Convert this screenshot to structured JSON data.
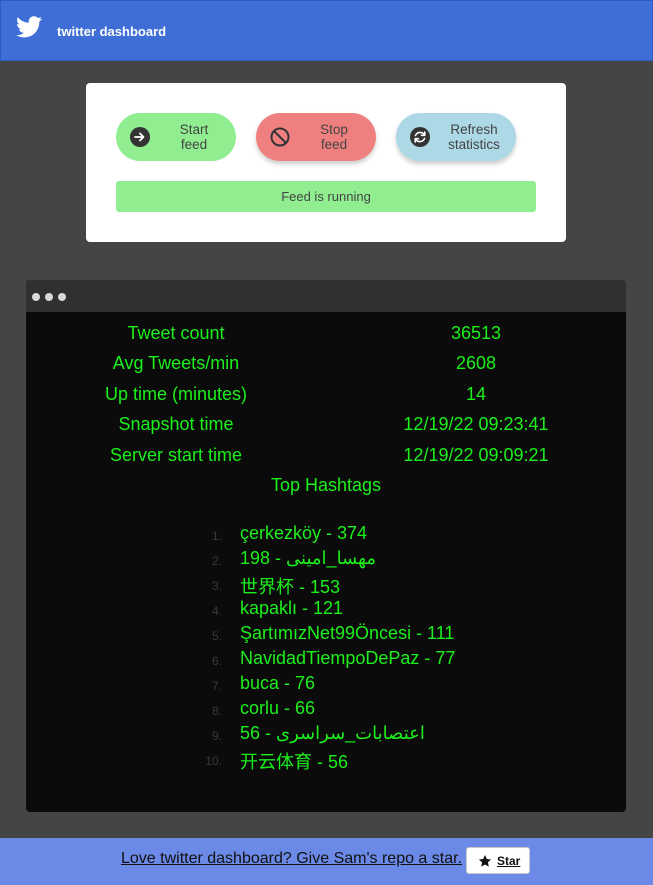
{
  "colors": {
    "header": "#3f6fd6",
    "background": "#454545",
    "start": "#90ee90",
    "stop": "#f08080",
    "refresh": "#add8e6",
    "terminal_text": "#1cf01c",
    "footer": "#6b89e6"
  },
  "header": {
    "title": "twitter dashboard",
    "logo_icon": "twitter-bird-icon"
  },
  "controls": {
    "start_label": "Start\nfeed",
    "stop_label": "Stop\nfeed",
    "refresh_label": "Refresh\nstatistics",
    "status": "Feed is running"
  },
  "stats": [
    {
      "label": "Tweet count",
      "value": "36513"
    },
    {
      "label": "Avg Tweets/min",
      "value": "2608"
    },
    {
      "label": "Up time (minutes)",
      "value": "14"
    },
    {
      "label": "Snapshot time",
      "value": "12/19/22 09:23:41"
    },
    {
      "label": "Server start time",
      "value": "12/19/22 09:09:21"
    }
  ],
  "top_hashtags_title": "Top Hashtags",
  "hashtags": [
    {
      "num": "1.",
      "text": "çerkezköy - 374"
    },
    {
      "num": "2.",
      "text": "مهسا_امینی - 198"
    },
    {
      "num": "3.",
      "text": "世界杯 - 153"
    },
    {
      "num": "4.",
      "text": "kapaklı - 121"
    },
    {
      "num": "5.",
      "text": "ŞartımızNet99Öncesi - 111"
    },
    {
      "num": "6.",
      "text": "NavidadTiempoDePaz - 77"
    },
    {
      "num": "7.",
      "text": "buca - 76"
    },
    {
      "num": "8.",
      "text": "corlu - 66"
    },
    {
      "num": "9.",
      "text": "اعتصابات_سراسری - 56"
    },
    {
      "num": "10.",
      "text": "开云体育 - 56"
    }
  ],
  "footer": {
    "link_text": "Love twitter dashboard? Give Sam's repo a star.",
    "star_label": "Star"
  }
}
